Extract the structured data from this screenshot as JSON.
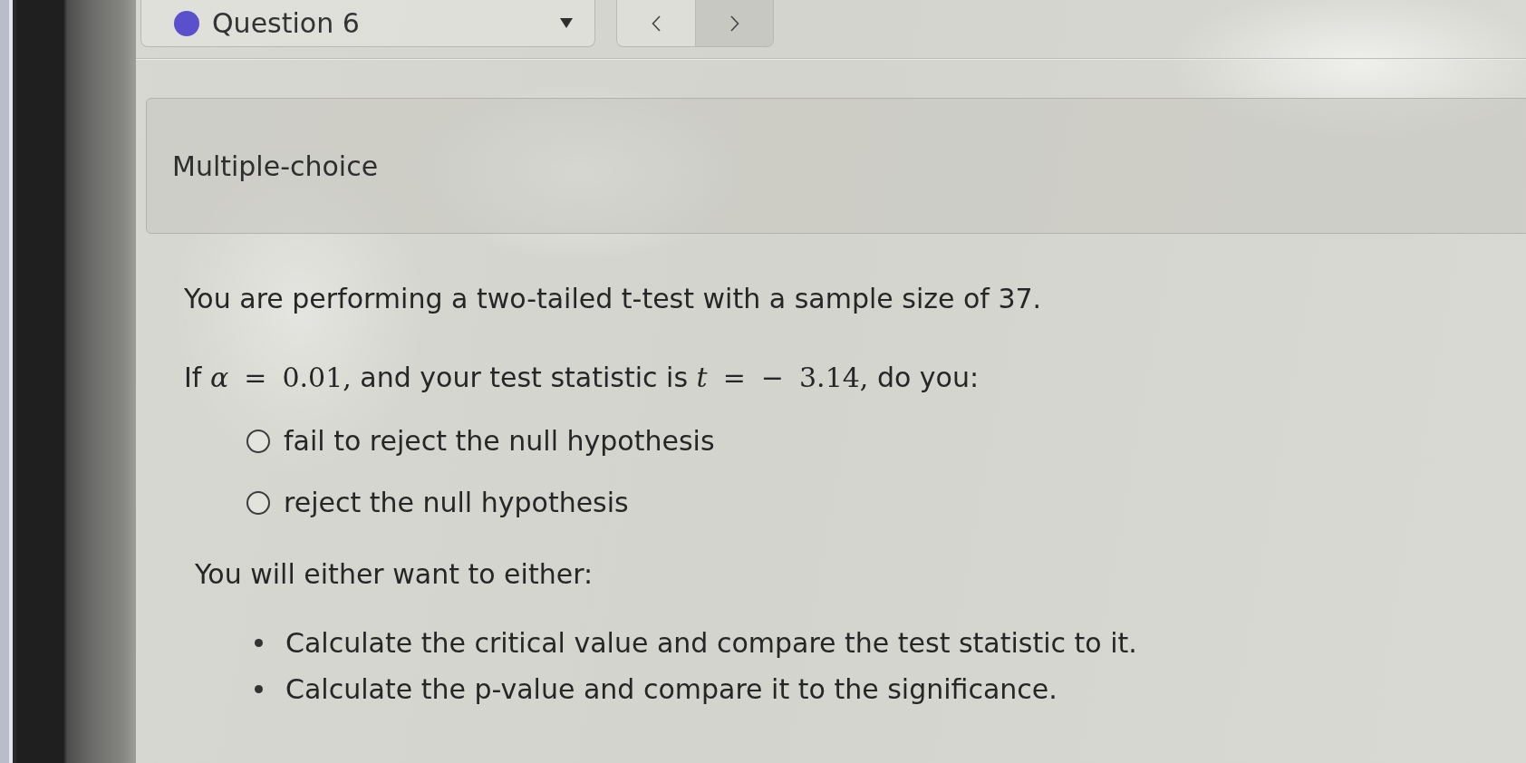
{
  "question_selector": {
    "label": "Question 6",
    "color": "#5b50cc"
  },
  "nav_buttons": [
    {
      "kind": "previous"
    },
    {
      "kind": "next"
    }
  ],
  "question_type": "Multiple-choice",
  "question": {
    "intro": "You are performing a two-tailed t-test with a sample size of 37.",
    "prompt": [
      {
        "kind": "text",
        "text": "If "
      },
      {
        "kind": "math",
        "text": "*α* = 0.01,"
      },
      {
        "kind": "text",
        "text": " and your test statistic is "
      },
      {
        "kind": "math",
        "text": "*t* = − 3.14,"
      },
      {
        "kind": "text",
        "text": " do you:"
      }
    ],
    "options": [
      {
        "label": "fail to reject the null hypothesis",
        "selected": false
      },
      {
        "label": "reject the null hypothesis",
        "selected": false
      }
    ],
    "hint": "You will either want to either:",
    "hint_items": [
      "Calculate the critical value and compare the test statistic to it.",
      "Calculate the p-value and compare it to the significance."
    ]
  }
}
